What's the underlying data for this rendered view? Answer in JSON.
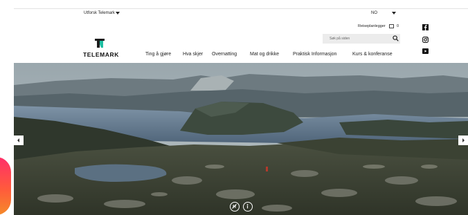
{
  "topbar": {
    "explore_label": "Utforsk Telemark",
    "language_label": "NO"
  },
  "header": {
    "logo_text": "TELEMARK",
    "planner_label": "Reiseplanlegger",
    "planner_count": "0",
    "search_placeholder": "Søk på siden",
    "nav": [
      {
        "label": "Ting å gjøre"
      },
      {
        "label": "Hva skjer"
      },
      {
        "label": "Overnatting"
      },
      {
        "label": "Mat og drikke"
      },
      {
        "label": "Praktisk Informasjon"
      },
      {
        "label": "Kurs & konferanse"
      }
    ]
  },
  "social": [
    "facebook-icon",
    "instagram-icon",
    "youtube-icon"
  ],
  "hero": {
    "controls": [
      "pause-icon",
      "info-icon"
    ]
  },
  "colors": {
    "logo_dark": "#1b1b1b",
    "logo_accent": "#1fbfa3",
    "search_bg": "#ececec",
    "instagram_gradient": "#ff2f6a"
  }
}
